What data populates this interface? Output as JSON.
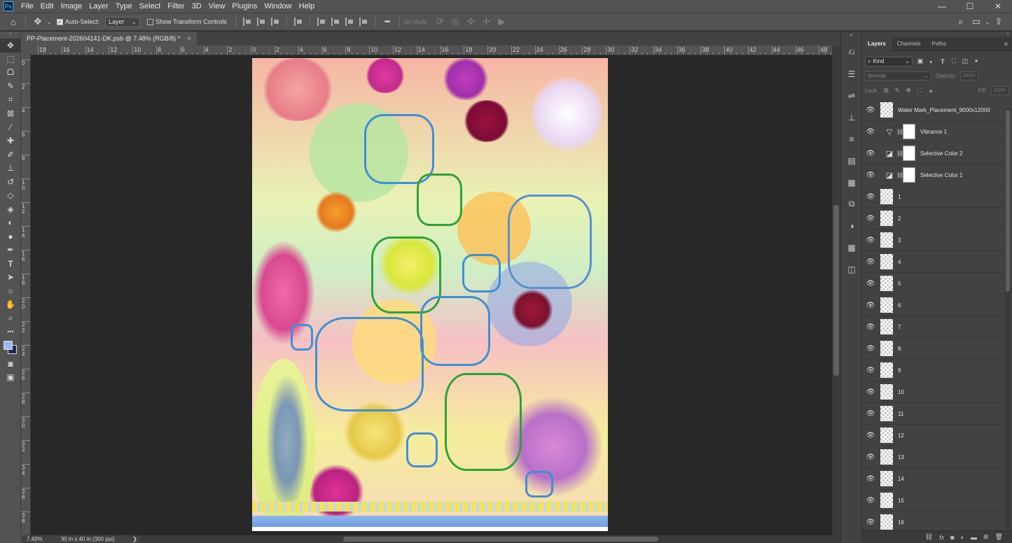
{
  "menubar": {
    "logo": "Ps",
    "items": [
      "File",
      "Edit",
      "Image",
      "Layer",
      "Type",
      "Select",
      "Filter",
      "3D",
      "View",
      "Plugins",
      "Window",
      "Help"
    ],
    "window_controls": [
      "—",
      "☐",
      "✕"
    ]
  },
  "optionsbar": {
    "auto_select_label": "Auto-Select:",
    "auto_select_checked": true,
    "auto_select_target": "Layer",
    "show_transform_label": "Show Transform Controls",
    "show_transform_checked": false,
    "more_label": "•••",
    "mode_3d_label": "3D Mode:"
  },
  "document": {
    "tab_title": "PP-Placement-202604141-DK.psb @ 7.48% (RGB/8) *",
    "close": "×"
  },
  "rulers": {
    "top_labels": [
      "18",
      "16",
      "14",
      "12",
      "10",
      "8",
      "6",
      "4",
      "2",
      "0",
      "2",
      "4",
      "6",
      "8",
      "10",
      "12",
      "14",
      "16",
      "18",
      "20",
      "22",
      "24",
      "26",
      "28",
      "30",
      "32",
      "34",
      "36",
      "38",
      "40",
      "42",
      "44",
      "46",
      "48"
    ],
    "left_labels": [
      "0",
      "2",
      "4",
      "6",
      "8",
      "10",
      "12",
      "14",
      "16",
      "18",
      "20",
      "22",
      "24",
      "26",
      "28",
      "30",
      "32",
      "34",
      "36",
      "38"
    ]
  },
  "statusbar": {
    "zoom": "7.48%",
    "doc_size": "30 in x 40 in (300 ppi)",
    "arrow": "❯"
  },
  "swatches": {
    "foreground": "#9bbcf0",
    "background": "#1c2950"
  },
  "layers_panel": {
    "tabs": [
      "Layers",
      "Channels",
      "Paths"
    ],
    "filter_kind": "Kind",
    "blend_mode": "Normal",
    "opacity_label": "Opacity:",
    "opacity_value": "100%",
    "lock_label": "Lock:",
    "fill_label": "Fill:",
    "fill_value": "100%",
    "layers": [
      {
        "name": "Water Mark_Placement_9000x12000",
        "type": "smart"
      },
      {
        "name": "Vibrance 1",
        "type": "adjustment",
        "icon": "vibrance-icon"
      },
      {
        "name": "Selective Color 2",
        "type": "adjustment",
        "icon": "selective-color-icon"
      },
      {
        "name": "Selective Color 1",
        "type": "adjustment",
        "icon": "selective-color-icon"
      },
      {
        "name": "1",
        "type": "pixel"
      },
      {
        "name": "2",
        "type": "pixel"
      },
      {
        "name": "3",
        "type": "pixel"
      },
      {
        "name": "4",
        "type": "pixel"
      },
      {
        "name": "5",
        "type": "pixel"
      },
      {
        "name": "6",
        "type": "pixel"
      },
      {
        "name": "7",
        "type": "pixel"
      },
      {
        "name": "8",
        "type": "pixel"
      },
      {
        "name": "9",
        "type": "pixel"
      },
      {
        "name": "10",
        "type": "pixel"
      },
      {
        "name": "11",
        "type": "pixel"
      },
      {
        "name": "12",
        "type": "pixel"
      },
      {
        "name": "13",
        "type": "pixel"
      },
      {
        "name": "14",
        "type": "pixel"
      },
      {
        "name": "15",
        "type": "pixel"
      },
      {
        "name": "16",
        "type": "pixel"
      }
    ]
  }
}
